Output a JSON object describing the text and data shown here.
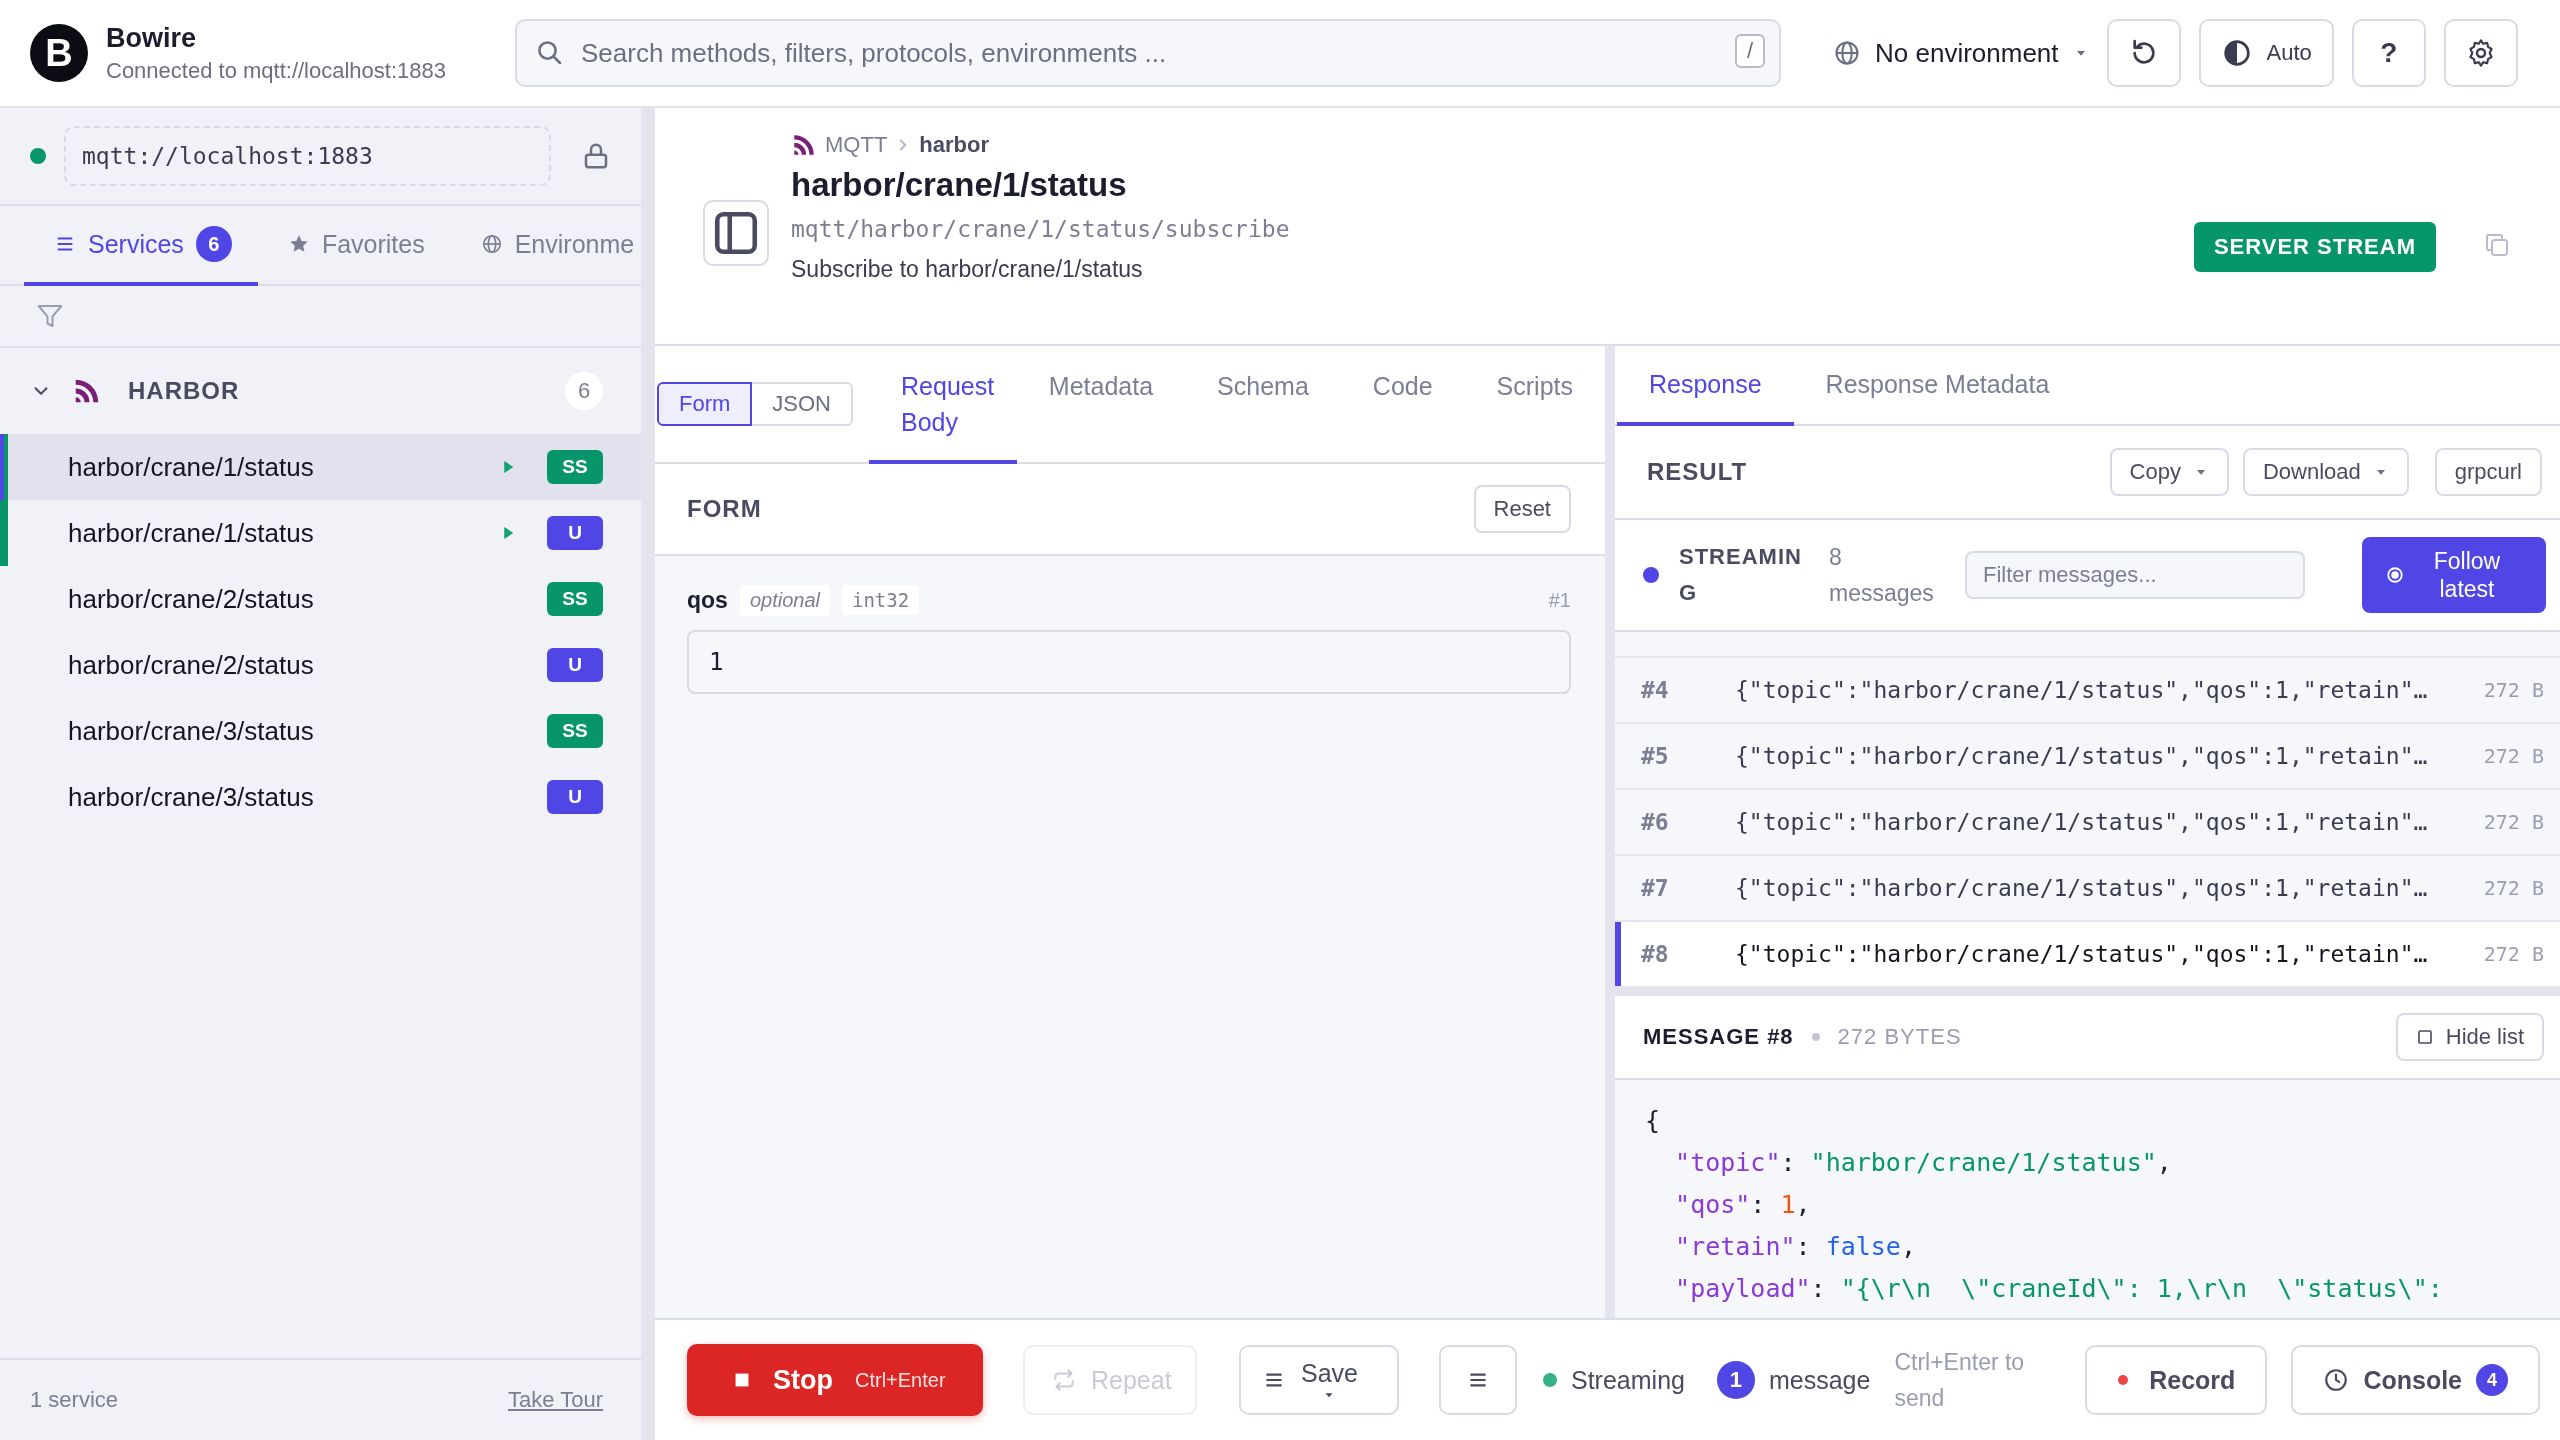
{
  "app": {
    "logo_letter": "B",
    "name": "Bowire",
    "subtitle": "Connected to mqtt://localhost:1883"
  },
  "search": {
    "placeholder": "Search methods, filters, protocols, environments ...",
    "shortcut": "/"
  },
  "environment": {
    "label": "No environment"
  },
  "theme_button": {
    "label": "Auto"
  },
  "help_button": {
    "label": "?"
  },
  "connection": {
    "url": "mqtt://localhost:1883",
    "connected": true
  },
  "sidebar_tabs": [
    {
      "label": "Services",
      "count": "6",
      "selected": true
    },
    {
      "label": "Favorites",
      "selected": false
    },
    {
      "label": "Environme",
      "selected": false
    }
  ],
  "service_group": {
    "name": "HARBOR",
    "count": "6",
    "expanded": true,
    "items": [
      {
        "name": "harbor/crane/1/status",
        "badge": "SS",
        "kind": "stream",
        "selected": true,
        "active": true
      },
      {
        "name": "harbor/crane/1/status",
        "badge": "U",
        "kind": "unary",
        "selected": false,
        "active": true
      },
      {
        "name": "harbor/crane/2/status",
        "badge": "SS",
        "kind": "stream",
        "selected": false,
        "active": false
      },
      {
        "name": "harbor/crane/2/status",
        "badge": "U",
        "kind": "unary",
        "selected": false,
        "active": false
      },
      {
        "name": "harbor/crane/3/status",
        "badge": "SS",
        "kind": "stream",
        "selected": false,
        "active": false
      },
      {
        "name": "harbor/crane/3/status",
        "badge": "U",
        "kind": "unary",
        "selected": false,
        "active": false
      }
    ]
  },
  "sidebar_footer": {
    "count": "1 service",
    "link": "Take Tour"
  },
  "method": {
    "breadcrumb": [
      "MQTT",
      "harbor"
    ],
    "title": "harbor/crane/1/status",
    "path": "mqtt/harbor/crane/1/status/subscribe",
    "description": "Subscribe to harbor/crane/1/status",
    "type_badge": "SERVER STREAM"
  },
  "request": {
    "modes": [
      {
        "label": "Form",
        "selected": true
      },
      {
        "label": "JSON",
        "selected": false
      }
    ],
    "tabs": [
      {
        "label": "Request Body",
        "selected": true
      },
      {
        "label": "Metadata",
        "selected": false
      },
      {
        "label": "Schema",
        "selected": false
      },
      {
        "label": "Code",
        "selected": false
      },
      {
        "label": "Scripts",
        "selected": false
      }
    ],
    "section": "FORM",
    "reset": "Reset",
    "fields": [
      {
        "name": "qos",
        "optional": "optional",
        "type": "int32",
        "number": "#1",
        "value": "1"
      }
    ]
  },
  "response": {
    "tabs": [
      {
        "label": "Response",
        "selected": true
      },
      {
        "label": "Response Metadata",
        "selected": false
      }
    ],
    "section": "RESULT",
    "actions": [
      {
        "label": "Copy",
        "dropdown": true
      },
      {
        "label": "Download",
        "dropdown": true
      },
      {
        "label": "grpcurl",
        "dropdown": false
      }
    ],
    "stream_status": "STREAMING",
    "message_count": "8 messages",
    "filter_placeholder": "Filter messages...",
    "follow_button": "Follow latest",
    "messages": [
      {
        "index": "#4",
        "preview": "{\"topic\":\"harbor/crane/1/status\",\"qos\":1,\"retain\"…",
        "size": "272 B",
        "selected": false
      },
      {
        "index": "#5",
        "preview": "{\"topic\":\"harbor/crane/1/status\",\"qos\":1,\"retain\"…",
        "size": "272 B",
        "selected": false
      },
      {
        "index": "#6",
        "preview": "{\"topic\":\"harbor/crane/1/status\",\"qos\":1,\"retain\"…",
        "size": "272 B",
        "selected": false
      },
      {
        "index": "#7",
        "preview": "{\"topic\":\"harbor/crane/1/status\",\"qos\":1,\"retain\"…",
        "size": "272 B",
        "selected": false
      },
      {
        "index": "#8",
        "preview": "{\"topic\":\"harbor/crane/1/status\",\"qos\":1,\"retain\"…",
        "size": "272 B",
        "selected": true
      }
    ],
    "detail": {
      "title": "MESSAGE #8",
      "size": "272 BYTES",
      "hide_button": "Hide list",
      "code_lines": [
        [
          {
            "kind": "punct",
            "text": "{"
          }
        ],
        [
          {
            "kind": "key",
            "text": "  \"topic\""
          },
          {
            "kind": "punct",
            "text": ": "
          },
          {
            "kind": "string",
            "text": "\"harbor/crane/1/status\""
          },
          {
            "kind": "punct",
            "text": ","
          }
        ],
        [
          {
            "kind": "key",
            "text": "  \"qos\""
          },
          {
            "kind": "punct",
            "text": ": "
          },
          {
            "kind": "number",
            "text": "1"
          },
          {
            "kind": "punct",
            "text": ","
          }
        ],
        [
          {
            "kind": "key",
            "text": "  \"retain\""
          },
          {
            "kind": "punct",
            "text": ": "
          },
          {
            "kind": "bool",
            "text": "false"
          },
          {
            "kind": "punct",
            "text": ","
          }
        ],
        [
          {
            "kind": "key",
            "text": "  \"payload\""
          },
          {
            "kind": "punct",
            "text": ": "
          },
          {
            "kind": "string",
            "text": "\"{\\r\\n  \\\"craneId\\\": 1,\\r\\n  \\\"status\\\":"
          }
        ]
      ]
    }
  },
  "toolbar": {
    "stop": {
      "label": "Stop",
      "shortcut": "Ctrl+Enter"
    },
    "repeat": {
      "label": "Repeat",
      "disabled": true
    },
    "save": {
      "label": "Save"
    },
    "status": {
      "label": "Streaming",
      "streaming": true
    },
    "message_count": "1",
    "message_label": "message",
    "hint": "Ctrl+Enter to send",
    "record": "Record",
    "console": {
      "label": "Console",
      "count": "4"
    }
  }
}
